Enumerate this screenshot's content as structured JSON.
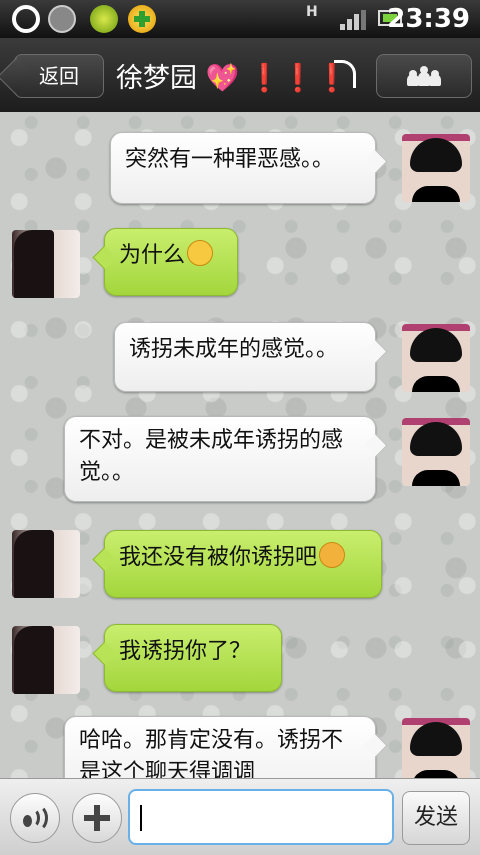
{
  "status_bar": {
    "network_label": "H",
    "time": "23:39",
    "icons": [
      "notification-ring-icon",
      "settings-gear-icon",
      "music-app-icon",
      "plus-app-icon",
      "signal-icon",
      "battery-icon"
    ]
  },
  "header": {
    "back_label": "返回",
    "title": "徐梦园",
    "title_emoji": "💖",
    "title_marks": "❗❗❗",
    "members_icon": "group-members-icon",
    "mode_icon": "earpiece-icon"
  },
  "messages": [
    {
      "side": "right",
      "text": "突然有一种罪恶感。。"
    },
    {
      "side": "left",
      "text": "为什么",
      "emoji": "smiley-icon"
    },
    {
      "side": "right",
      "text": "诱拐未成年的感觉。。"
    },
    {
      "side": "right",
      "text": "不对。是被未成年诱拐的感觉。。"
    },
    {
      "side": "left",
      "text": "我还没有被你诱拐吧",
      "emoji": "angry-smiley-icon"
    },
    {
      "side": "left",
      "text": "我诱拐你了？"
    },
    {
      "side": "right",
      "text": "哈哈。那肯定没有。诱拐不是这个聊天得调调"
    }
  ],
  "input_bar": {
    "voice_icon": "voice-icon",
    "plus_icon": "plus-icon",
    "input_value": "",
    "send_label": "发送"
  },
  "colors": {
    "outgoing_bubble": "#ffffff",
    "incoming_bubble": "#b5e24f",
    "input_focus": "#6ab0e8"
  }
}
